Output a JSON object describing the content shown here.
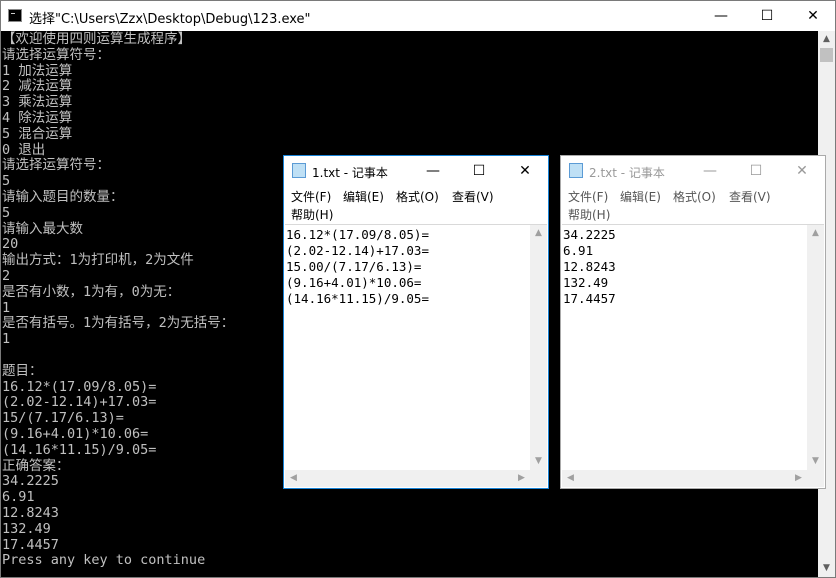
{
  "console": {
    "title": "选择\"C:\\Users\\Zzx\\Desktop\\Debug\\123.exe\"",
    "lines": [
      "【欢迎使用四则运算生成程序】",
      "请选择运算符号：",
      "1 加法运算",
      "2 减法运算",
      "3 乘法运算",
      "4 除法运算",
      "5 混合运算",
      "0 退出",
      "请选择运算符号：",
      "5",
      "请输入题目的数量：",
      "5",
      "请输入最大数",
      "20",
      "输出方式：1为打印机，2为文件",
      "2",
      "是否有小数，1为有，0为无：",
      "1",
      "是否有括号。1为有括号，2为无括号：",
      "1",
      "",
      "题目：",
      "16.12*(17.09/8.05)=",
      "(2.02-12.14)+17.03=",
      "15/(7.17/6.13)=",
      "(9.16+4.01)*10.06=",
      "(14.16*11.15)/9.05=",
      "正确答案：",
      "34.2225",
      "6.91",
      "12.8243",
      "132.49",
      "17.4457",
      "Press any key to continue"
    ]
  },
  "notepad1": {
    "title": "1.txt - 记事本",
    "menu": [
      "文件(F)",
      "编辑(E)",
      "格式(O)",
      "查看(V)",
      "帮助(H)"
    ],
    "lines": [
      "16.12*(17.09/8.05)=",
      "(2.02-12.14)+17.03=",
      "15.00/(7.17/6.13)=",
      "(9.16+4.01)*10.06=",
      "(14.16*11.15)/9.05="
    ]
  },
  "notepad2": {
    "title": "2.txt - 记事本",
    "menu": [
      "文件(F)",
      "编辑(E)",
      "格式(O)",
      "查看(V)",
      "帮助(H)"
    ],
    "lines": [
      "34.2225",
      "6.91",
      "12.8243",
      "132.49",
      "17.4457"
    ]
  },
  "icons": {
    "minimize": "—",
    "maximize": "☐",
    "close": "✕",
    "up": "▲",
    "down": "▼",
    "left": "◀",
    "right": "▶"
  }
}
